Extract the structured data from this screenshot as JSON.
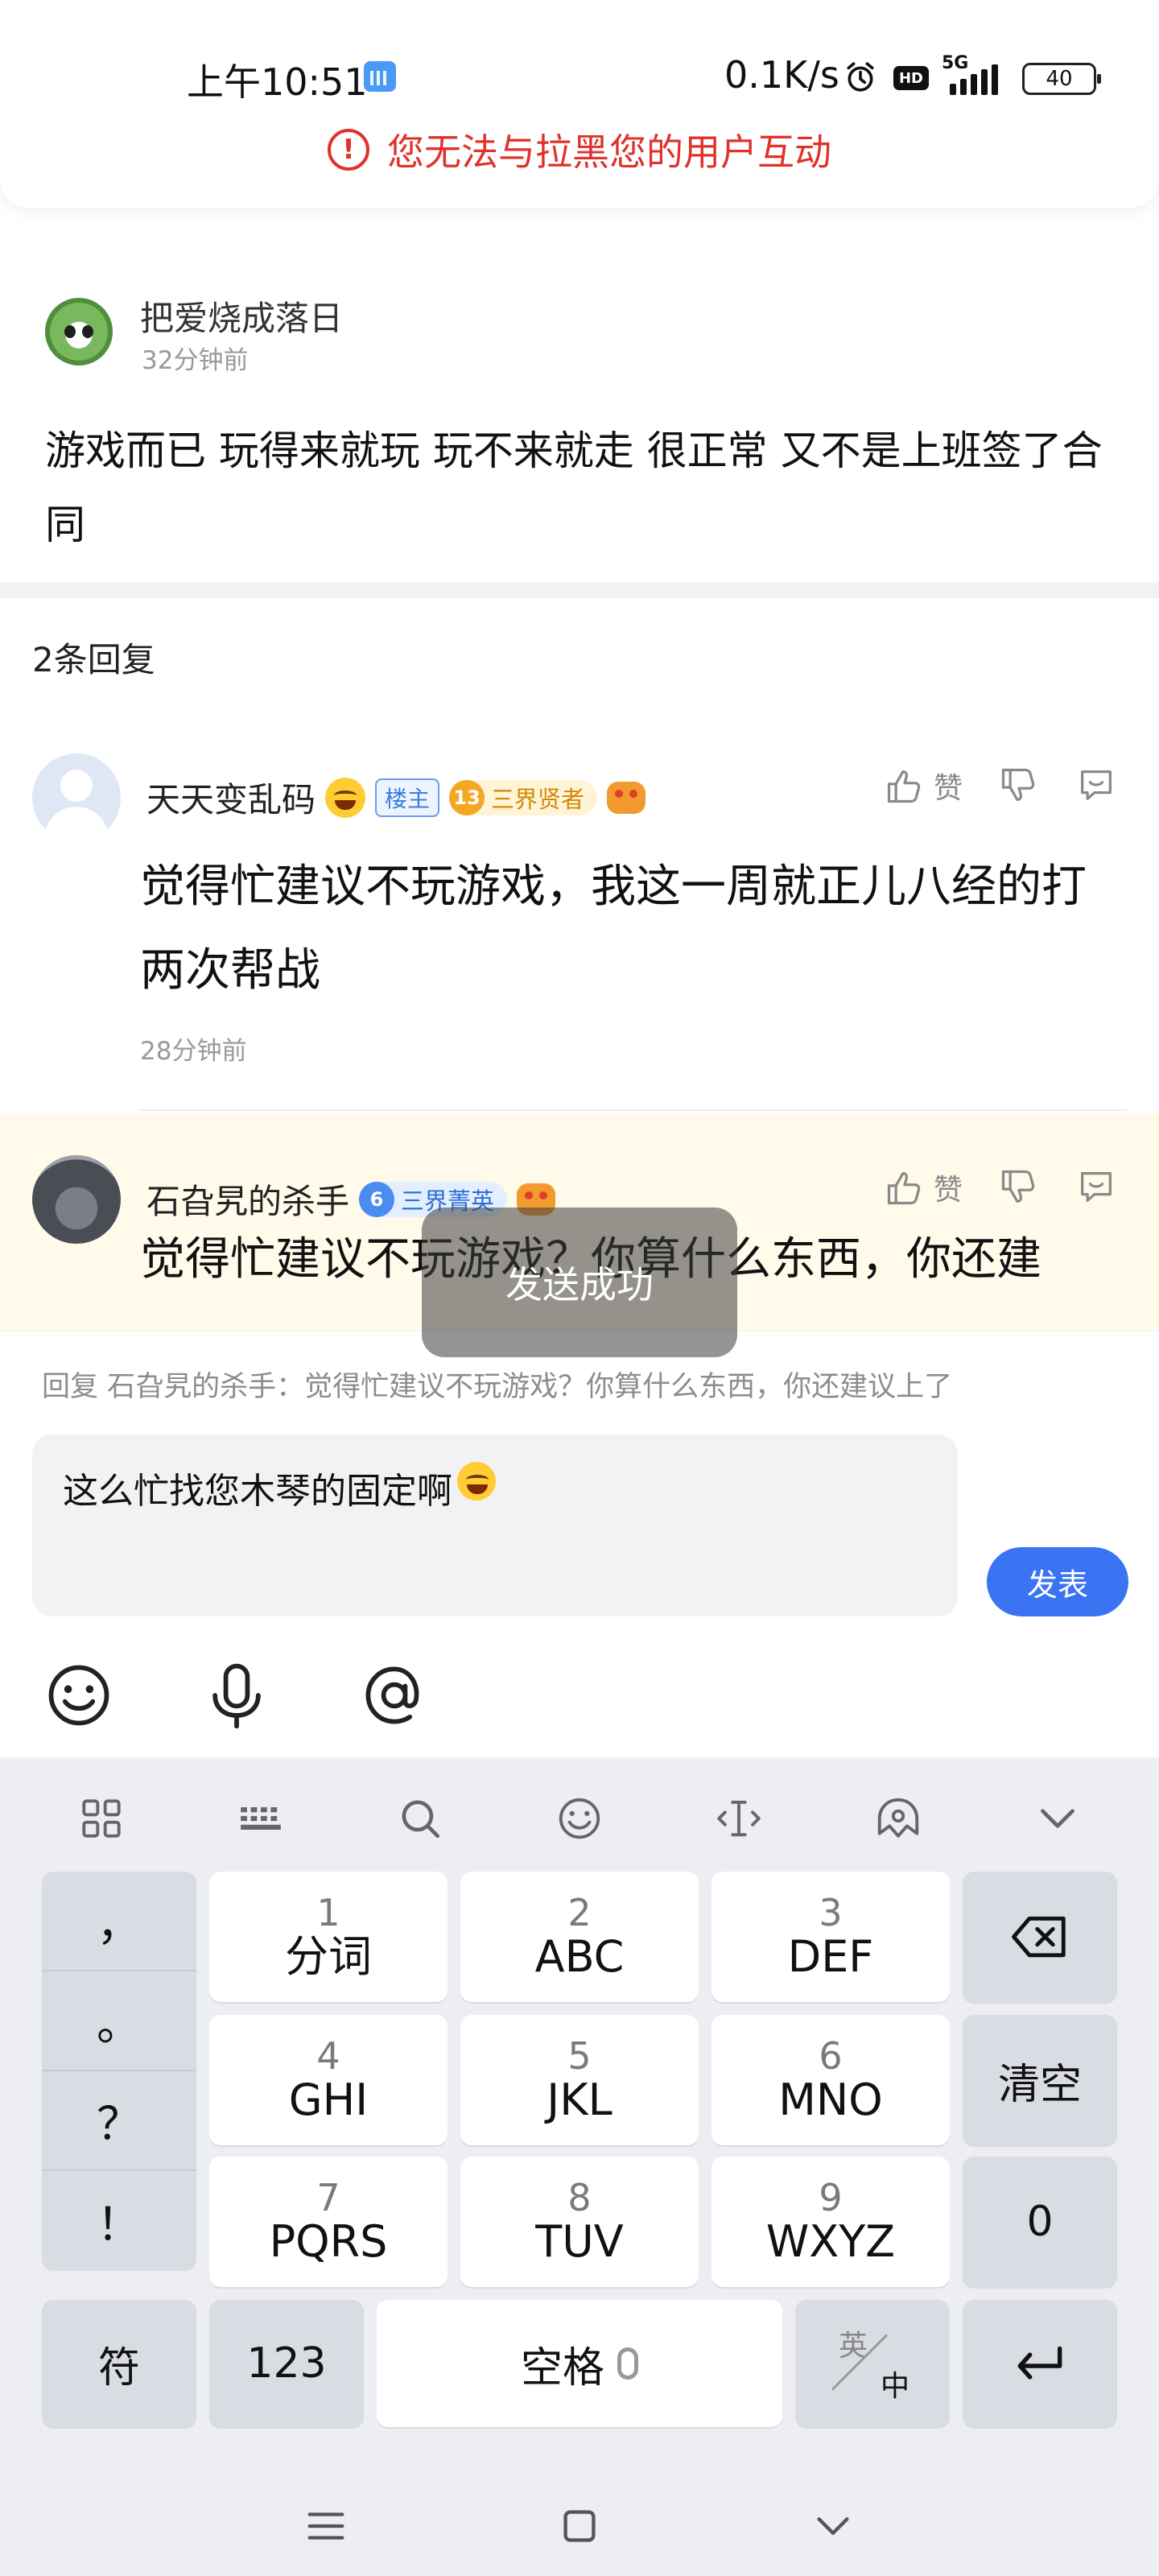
{
  "status_bar": {
    "time": "上午10:51",
    "net_speed": "0.1K/s",
    "hd_label": "HD",
    "network_label": "5G",
    "battery_level": "40",
    "icons": [
      "calendar-icon",
      "alarm-icon",
      "hd-icon",
      "signal-icon",
      "battery-icon"
    ]
  },
  "warning": {
    "icon": "alert-circle-icon",
    "text": "您无法与拉黑您的用户互动",
    "color": "#e0312b"
  },
  "post": {
    "author": "把爱烧成落日",
    "time_ago": "32分钟前",
    "content": "游戏而已 玩得来就玩 玩不来就走 很正常 又不是上班签了合同"
  },
  "replies_header": "2条回复",
  "replies": [
    {
      "author": "天天变乱码",
      "host_badge": "楼主",
      "level": "13",
      "title_badge": "三界贤者",
      "like_label": "赞",
      "content": "觉得忙建议不玩游戏，我这一周就正儿八经的打两次帮战",
      "time_ago": "28分钟前"
    },
    {
      "author": "石旮旯的杀手",
      "level": "6",
      "title_badge": "三界菁英",
      "like_label": "赞",
      "content": "觉得忙建议不玩游戏？你算什么东西，你还建"
    }
  ],
  "toast": "发送成功",
  "composer": {
    "reply_hint": "回复 石旮旯的杀手：觉得忙建议不玩游戏？你算什么东西，你还建议上了",
    "input_value": "这么忙找您木琴的固定啊",
    "send_label": "发表",
    "accent": "#3b74f2"
  },
  "keyboard": {
    "punctuation": [
      "，",
      "。",
      "？",
      "！"
    ],
    "keys": [
      {
        "num": "1",
        "letters": "分词"
      },
      {
        "num": "2",
        "letters": "ABC"
      },
      {
        "num": "3",
        "letters": "DEF"
      },
      {
        "num": "4",
        "letters": "GHI"
      },
      {
        "num": "5",
        "letters": "JKL"
      },
      {
        "num": "6",
        "letters": "MNO"
      },
      {
        "num": "7",
        "letters": "PQRS"
      },
      {
        "num": "8",
        "letters": "TUV"
      },
      {
        "num": "9",
        "letters": "WXYZ"
      }
    ],
    "clear_label": "清空",
    "zero_label": "0",
    "symbol_label": "符",
    "numeric_label": "123",
    "space_label": "空格",
    "lang_en": "英",
    "lang_zh": "中"
  }
}
